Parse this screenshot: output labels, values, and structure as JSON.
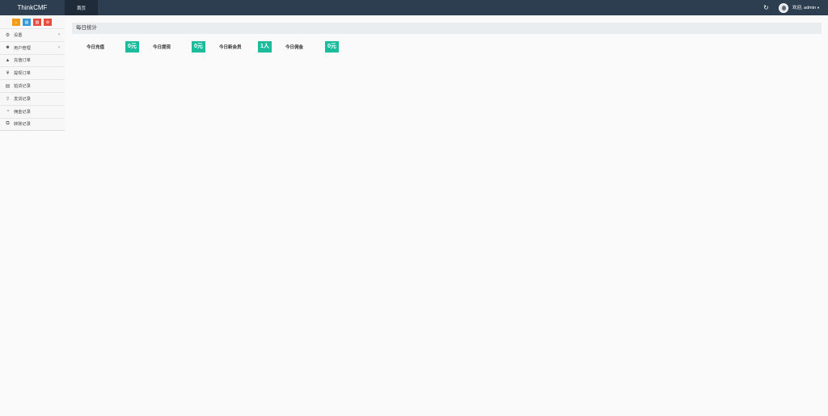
{
  "header": {
    "brand": "ThinkCMF",
    "home_tab": "首页",
    "user_menu": "欢迎, admin",
    "refresh_icon": "refresh-icon",
    "caret_icon": "caret-down-icon"
  },
  "sidebar": {
    "shortcuts": [
      {
        "icon": "home-icon",
        "color": "#f39c12"
      },
      {
        "icon": "file-icon",
        "color": "#3498db"
      },
      {
        "icon": "trash-icon",
        "color": "#e74c3c"
      },
      {
        "icon": "gear-icon",
        "color": "#e74c3c"
      }
    ],
    "items": [
      {
        "label": "设置",
        "icon": "cogs-icon",
        "has_children": true
      },
      {
        "label": "用户管理",
        "icon": "users-icon",
        "has_children": true
      },
      {
        "label": "充值订单",
        "icon": "area-chart-icon",
        "has_children": false
      },
      {
        "label": "提现订单",
        "icon": "yen-icon",
        "has_children": false
      },
      {
        "label": "拍货记录",
        "icon": "bar-chart-icon",
        "has_children": false
      },
      {
        "label": "发货记录",
        "icon": "upload-icon",
        "has_children": false
      },
      {
        "label": "佣金记录",
        "icon": "pie-chart-icon",
        "has_children": false
      },
      {
        "label": "转账记录",
        "icon": "clone-icon",
        "has_children": false
      }
    ]
  },
  "main": {
    "panel_title": "每日统计",
    "stats": [
      {
        "label": "今日充值",
        "value": "0元"
      },
      {
        "label": "今日提现",
        "value": "0元"
      },
      {
        "label": "今日新会员",
        "value": "1人"
      },
      {
        "label": "今日佣金",
        "value": "0元"
      }
    ]
  },
  "colors": {
    "topbar": "#2c3e50",
    "accent": "#1abc9c"
  }
}
